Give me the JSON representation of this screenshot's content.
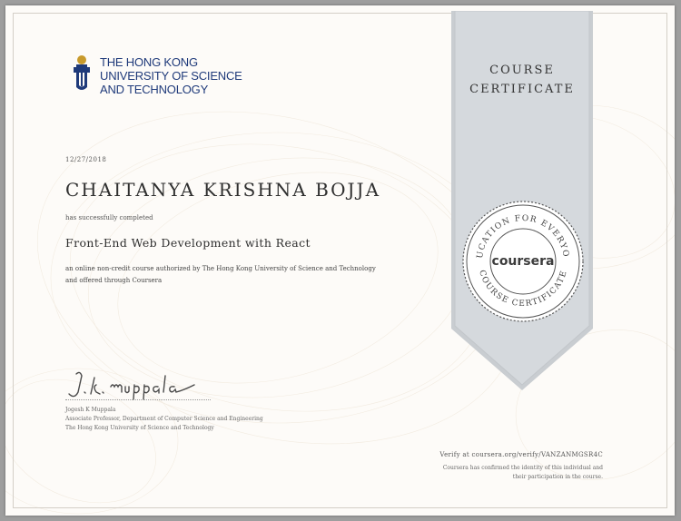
{
  "institution": {
    "line1": "THE HONG KONG",
    "line2": "UNIVERSITY OF SCIENCE",
    "line3": "AND TECHNOLOGY",
    "brand_color": "#1f3a7a",
    "icon": "hkust-crest-icon"
  },
  "certificate": {
    "date": "12/27/2018",
    "recipient": "CHAITANYA KRISHNA BOJJA",
    "completed_text": "has successfully completed",
    "course_title": "Front-End Web Development with React",
    "description": "an online non-credit course authorized by The Hong Kong University of Science and Technology and offered through Coursera"
  },
  "signer": {
    "name": "Jogesh K Muppala",
    "title": "Associate Professor, Department of Computer Science and Engineering",
    "affiliation": "The Hong Kong University of Science and Technology",
    "signature_text": "J. K. muppala"
  },
  "ribbon": {
    "line1": "COURSE",
    "line2": "CERTIFICATE",
    "color": "#d2d6da"
  },
  "seal": {
    "brand": "coursera",
    "top_arc": "EDUCATION FOR EVERYONE",
    "bottom_arc": "COURSE CERTIFICATE"
  },
  "verification": {
    "url_text": "Verify at coursera.org/verify/VANZANMGSR4C",
    "note_line1": "Coursera has confirmed the identity of this individual and",
    "note_line2": "their participation in the course."
  }
}
